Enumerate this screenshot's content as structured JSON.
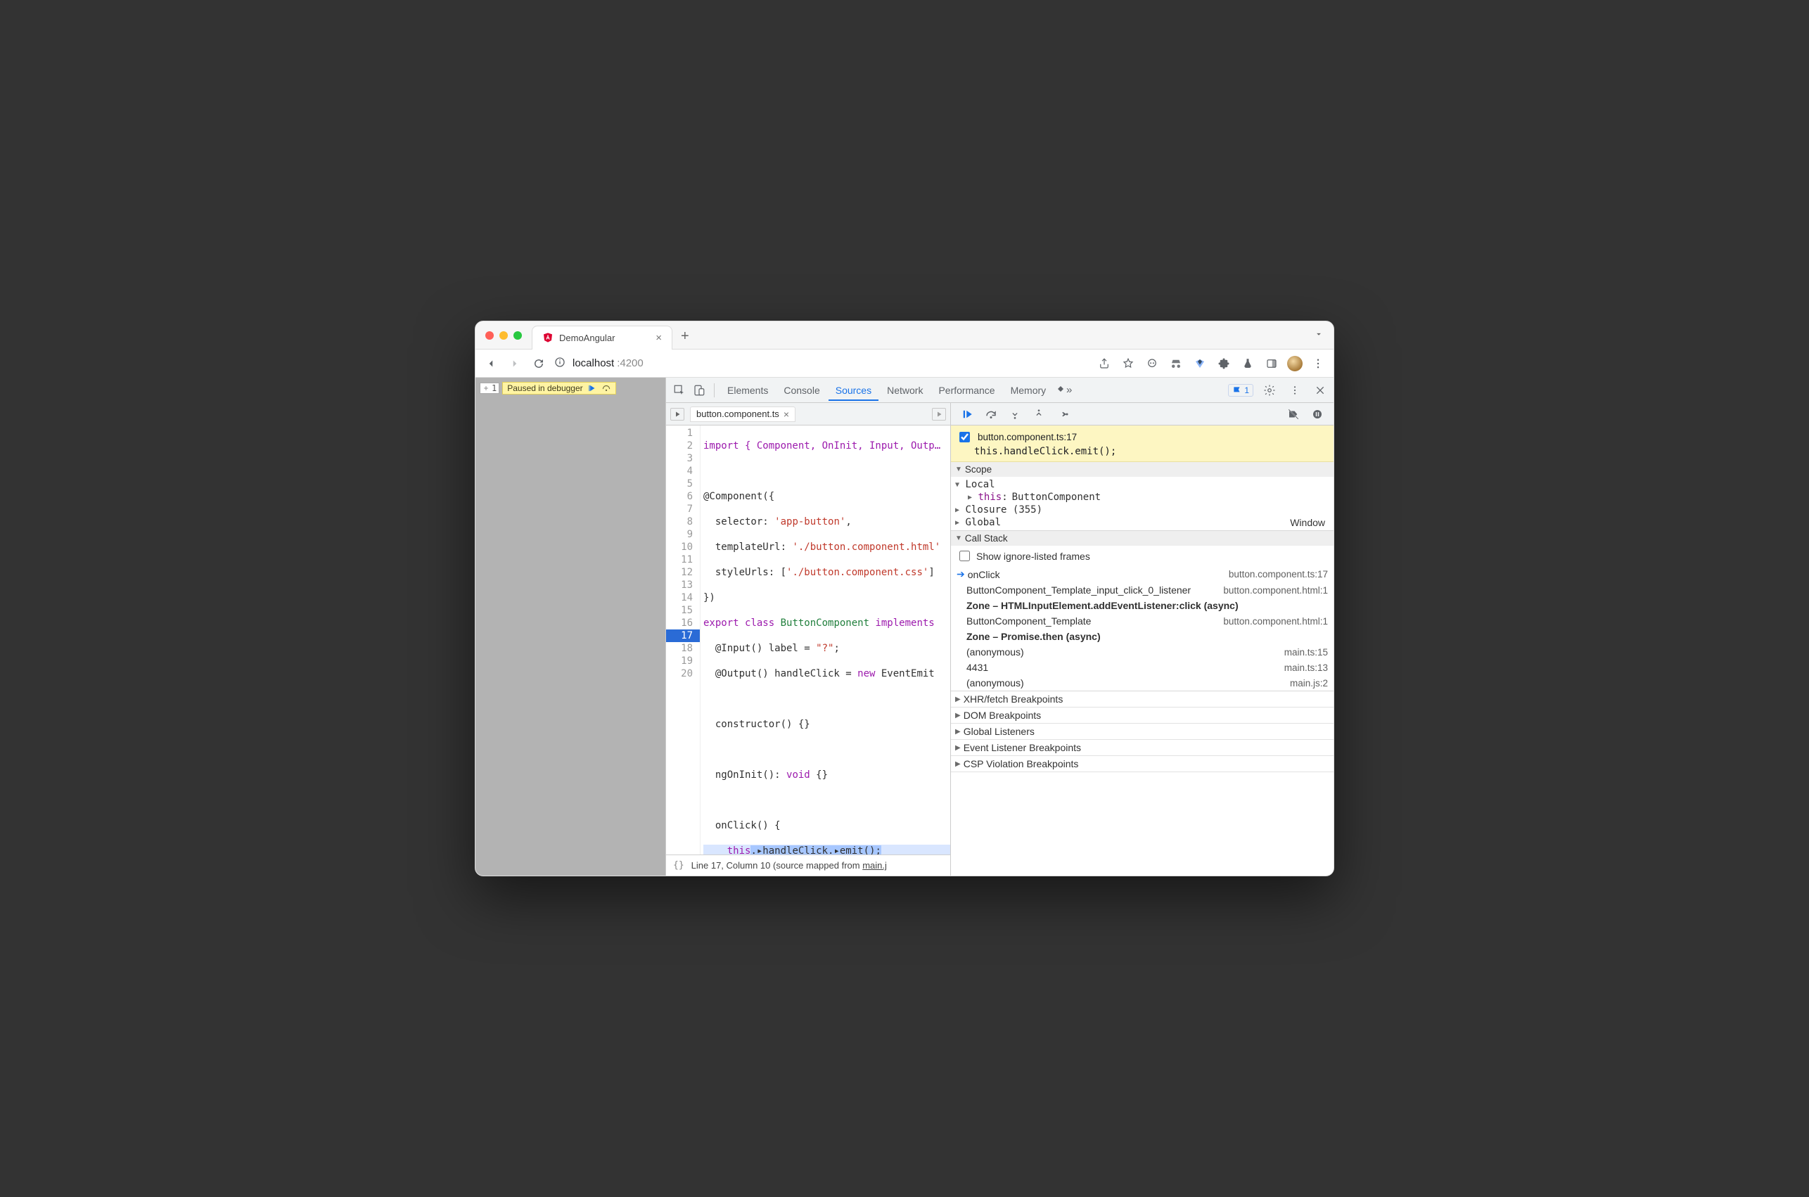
{
  "window": {
    "tab_title": "DemoAngular",
    "url_host": "localhost",
    "url_port": ":4200"
  },
  "page": {
    "frame_index": "1",
    "paused_label": "Paused in debugger"
  },
  "devtools": {
    "tabs": {
      "elements": "Elements",
      "console": "Console",
      "sources": "Sources",
      "network": "Network",
      "performance": "Performance",
      "memory": "Memory"
    },
    "issues_count": "1"
  },
  "editor": {
    "filename": "button.component.ts",
    "gutter": [
      "1",
      "2",
      "3",
      "4",
      "5",
      "6",
      "7",
      "8",
      "9",
      "10",
      "11",
      "12",
      "13",
      "14",
      "15",
      "16",
      "17",
      "18",
      "19",
      "20"
    ],
    "highlight_line_index": 16,
    "lines": {
      "l1": "import { Component, OnInit, Input, Outp…",
      "l2": "",
      "l3": "@Component({",
      "l4a": "  selector: ",
      "l4b": "'app-button'",
      "l4c": ",",
      "l5a": "  templateUrl: ",
      "l5b": "'./button.component.html'",
      "l6a": "  styleUrls: [",
      "l6b": "'./button.component.css'",
      "l6c": "]",
      "l7": "})",
      "l8a": "export ",
      "l8b": "class ",
      "l8c": "ButtonComponent ",
      "l8d": "implements",
      "l9a": "  @Input() label = ",
      "l9b": "\"?\"",
      "l9c": ";",
      "l10a": "  @Output() handleClick = ",
      "l10b": "new",
      "l10c": " EventEmit",
      "l11": "",
      "l12": "  constructor() {}",
      "l13": "",
      "l14a": "  ngOnInit(): ",
      "l14b": "void",
      "l14c": " {}",
      "l15": "",
      "l16": "  onClick() {",
      "l17a": "    ",
      "l17b": "this",
      "l17c": ".▸handleClick.▸emit();",
      "l18": "  }",
      "l19": "}",
      "l20": ""
    },
    "status_line": "Line 17, Column 10",
    "status_mapped_prefix": "(source mapped from ",
    "status_mapped_link": "main.j"
  },
  "debugger": {
    "breakpoint": {
      "file": "button.component.ts:17",
      "code": "this.handleClick.emit();"
    },
    "scope_title": "Scope",
    "scope_local": "Local",
    "scope_this_label": "this",
    "scope_this_value": "ButtonComponent",
    "scope_closure": "Closure (355)",
    "scope_global": "Global",
    "scope_global_value": "Window",
    "callstack_title": "Call Stack",
    "show_ignore_label": "Show ignore-listed frames",
    "frames": [
      {
        "name": "onClick",
        "loc": "button.component.ts:17",
        "current": true
      },
      {
        "name": "ButtonComponent_Template_input_click_0_listener",
        "loc": "button.component.html:1"
      },
      {
        "name": "Zone – HTMLInputElement.addEventListener:click (async)",
        "async": true
      },
      {
        "name": "ButtonComponent_Template",
        "loc": "button.component.html:1"
      },
      {
        "name": "Zone – Promise.then (async)",
        "async": true
      },
      {
        "name": "(anonymous)",
        "loc": "main.ts:15"
      },
      {
        "name": "4431",
        "loc": "main.ts:13"
      },
      {
        "name": "(anonymous)",
        "loc": "main.js:2"
      }
    ],
    "sections": {
      "xhr": "XHR/fetch Breakpoints",
      "dom": "DOM Breakpoints",
      "global": "Global Listeners",
      "event": "Event Listener Breakpoints",
      "csp": "CSP Violation Breakpoints"
    }
  }
}
